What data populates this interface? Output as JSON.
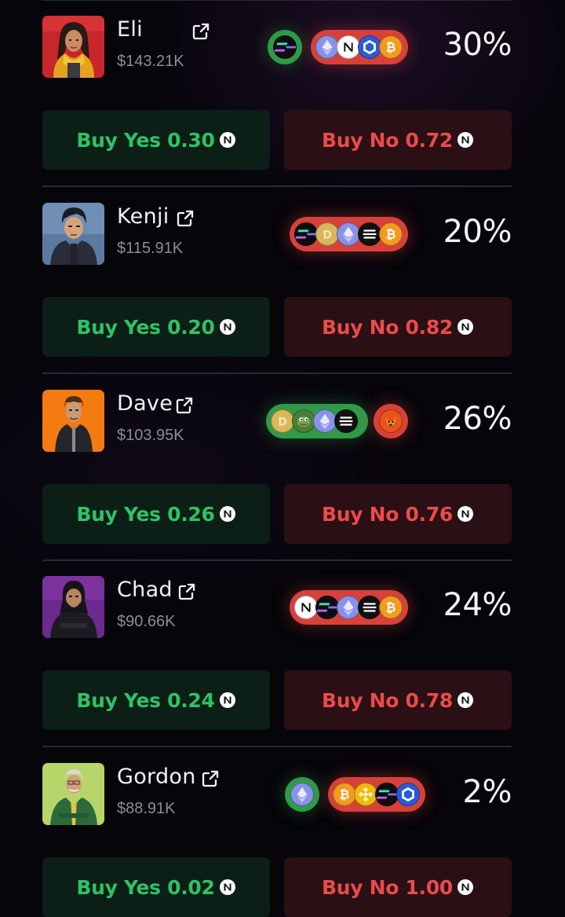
{
  "token_symbol_icon": "near-n-icon",
  "colors": {
    "yes_text": "#2ec266",
    "no_text": "#ec4a4a",
    "pill_red": "#d8403a",
    "pill_green": "#2f9a47"
  },
  "traders": [
    {
      "name": "Eli",
      "worth": "$143.21K",
      "percent": "30%",
      "avatar": "eli-avatar",
      "buy_yes": "Buy Yes 0.30",
      "buy_no": "Buy No 0.72",
      "holdings": [
        {
          "color": "green",
          "coins": [
            "solana"
          ]
        },
        {
          "color": "red",
          "coins": [
            "ethereum",
            "near",
            "chainlink",
            "bitcoin"
          ]
        }
      ]
    },
    {
      "name": "Kenji",
      "worth": "$115.91K",
      "percent": "20%",
      "avatar": "kenji-avatar",
      "buy_yes": "Buy Yes 0.20",
      "buy_no": "Buy No 0.82",
      "holdings": [
        {
          "color": "red",
          "coins": [
            "solana",
            "dogecoin",
            "ethereum",
            "ethena",
            "bitcoin"
          ]
        }
      ]
    },
    {
      "name": "Dave",
      "worth": "$103.95K",
      "percent": "26%",
      "avatar": "dave-avatar",
      "buy_yes": "Buy Yes 0.26",
      "buy_no": "Buy No 0.76",
      "holdings": [
        {
          "color": "green",
          "coins": [
            "dogecoin",
            "pepe",
            "ethereum",
            "ethena"
          ]
        },
        {
          "color": "red",
          "coins": [
            "shiba-inu"
          ]
        }
      ]
    },
    {
      "name": "Chad",
      "worth": "$90.66K",
      "percent": "24%",
      "avatar": "chad-avatar",
      "buy_yes": "Buy Yes 0.24",
      "buy_no": "Buy No 0.78",
      "holdings": [
        {
          "color": "red",
          "coins": [
            "near",
            "solana",
            "ethereum",
            "ethena",
            "bitcoin"
          ]
        }
      ]
    },
    {
      "name": "Gordon",
      "worth": "$88.91K",
      "percent": "2%",
      "avatar": "gordon-avatar",
      "buy_yes": "Buy Yes 0.02",
      "buy_no": "Buy No 1.00",
      "holdings": [
        {
          "color": "green",
          "coins": [
            "ethereum"
          ]
        },
        {
          "color": "red",
          "coins": [
            "bitcoin",
            "bnb",
            "solana",
            "chainlink"
          ]
        }
      ]
    }
  ]
}
